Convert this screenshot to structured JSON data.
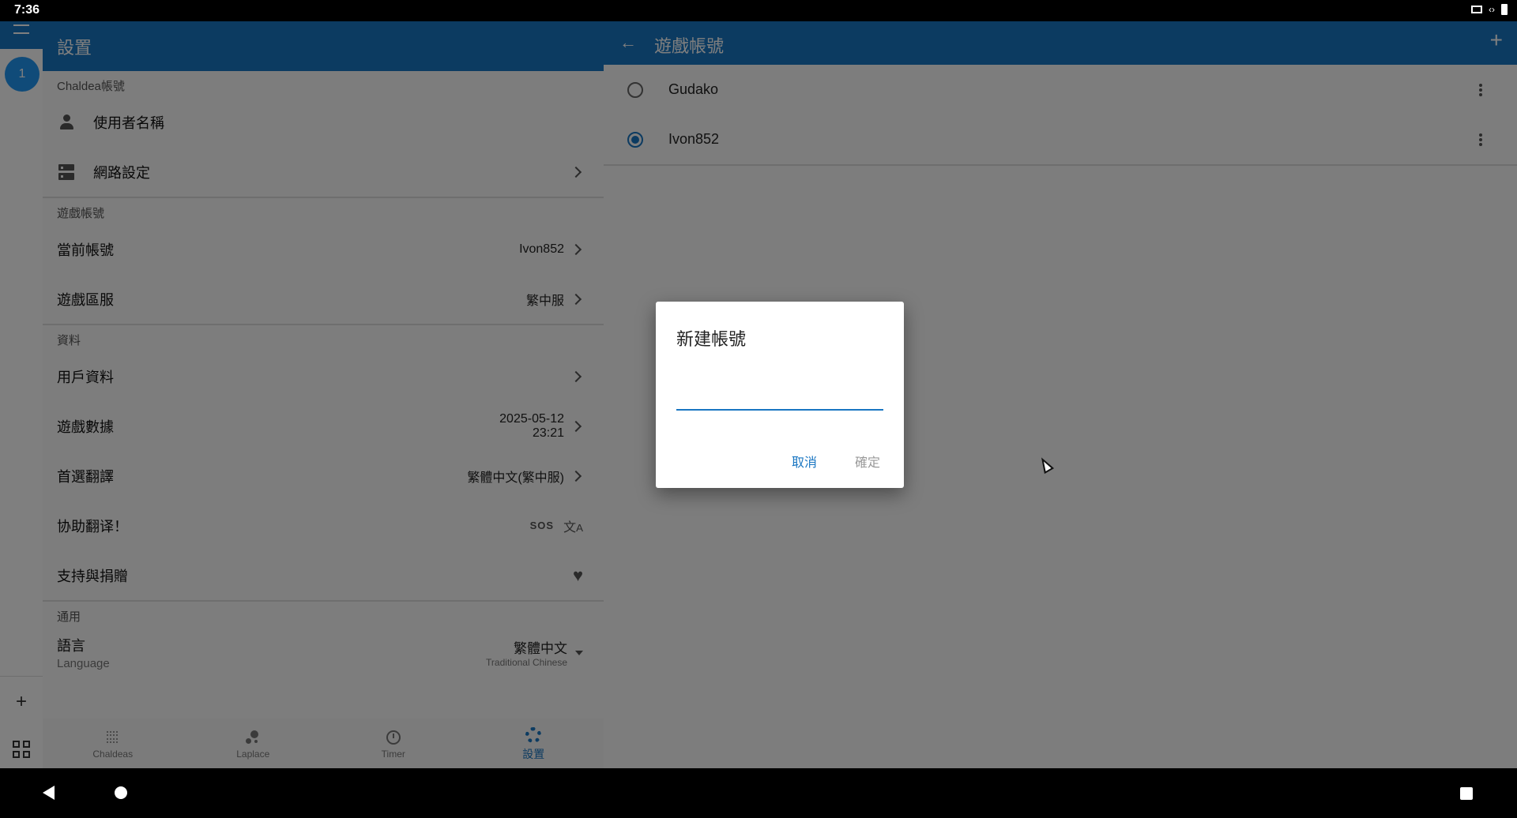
{
  "status_bar": {
    "time": "7:36"
  },
  "rail": {
    "badge": "1",
    "plus": "+"
  },
  "settings": {
    "header_title": "設置",
    "sections": {
      "chaldea": {
        "title": "Chaldea帳號",
        "username_label": "使用者名稱",
        "network_label": "網路設定"
      },
      "game_account": {
        "title": "遊戲帳號",
        "current_label": "當前帳號",
        "current_value": "Ivon852",
        "region_label": "遊戲區服",
        "region_value": "繁中服"
      },
      "data": {
        "title": "資料",
        "user_data_label": "用戶資料",
        "game_data_label": "遊戲數據",
        "game_data_date": "2025-05-12",
        "game_data_time": "23:21",
        "preferred_translation_label": "首選翻譯",
        "preferred_translation_value": "繁體中文(繁中服)",
        "help_translate_label": "协助翻译！",
        "help_translate_badge": "SOS",
        "support_label": "支持與捐贈"
      },
      "general": {
        "title": "通用",
        "language_label": "語言",
        "language_sub": "Language",
        "language_value": "繁體中文",
        "language_value_sub": "Traditional Chinese"
      }
    }
  },
  "bottom_nav": [
    {
      "label": "Chaldeas",
      "icon": "dots-grid-icon"
    },
    {
      "label": "Laplace",
      "icon": "bubbles-icon"
    },
    {
      "label": "Timer",
      "icon": "timer-icon"
    },
    {
      "label": "設置",
      "icon": "gear-icon",
      "active": true
    }
  ],
  "accounts_panel": {
    "title": "遊戲帳號",
    "accounts": [
      {
        "name": "Gudako",
        "selected": false
      },
      {
        "name": "Ivon852",
        "selected": true
      }
    ]
  },
  "dialog": {
    "title": "新建帳號",
    "input_value": "",
    "cancel_label": "取消",
    "confirm_label": "確定"
  },
  "colors": {
    "primary": "#1976c2",
    "badge": "#2196f3",
    "scrim": "rgba(0,0,0,0.5)"
  }
}
